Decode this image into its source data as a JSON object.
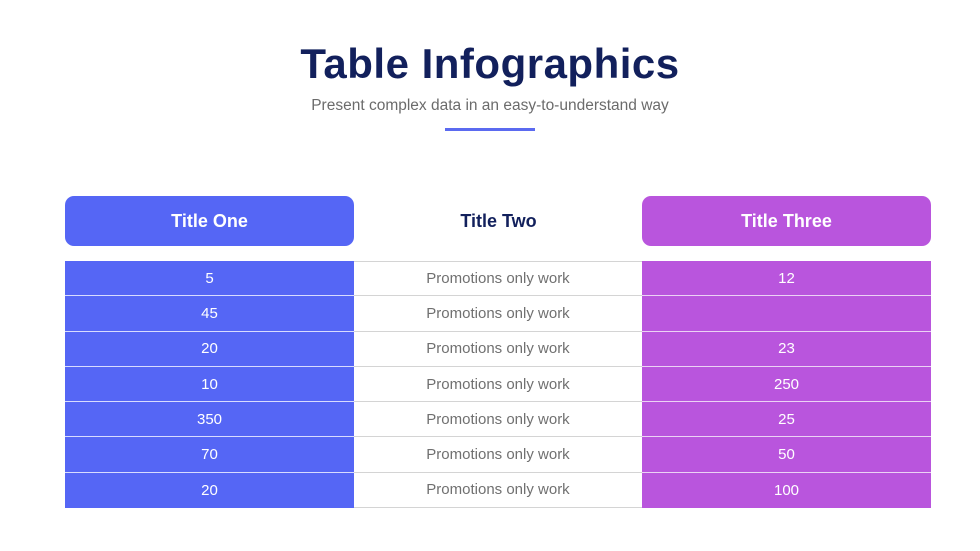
{
  "header": {
    "title": "Table Infographics",
    "subtitle": "Present complex data in an easy-to-understand way"
  },
  "colors": {
    "title": "#12205c",
    "column_one": "#5566f5",
    "column_three": "#b955dd",
    "accent_line": "#5b6af0"
  },
  "table": {
    "columns": [
      "Title One",
      "Title Two",
      "Title Three"
    ],
    "rows": [
      [
        "5",
        "Promotions only work",
        "12"
      ],
      [
        "45",
        "Promotions only work",
        ""
      ],
      [
        "20",
        "Promotions only work",
        "23"
      ],
      [
        "10",
        "Promotions only work",
        "250"
      ],
      [
        "350",
        "Promotions only work",
        "25"
      ],
      [
        "70",
        "Promotions only work",
        "50"
      ],
      [
        "20",
        "Promotions only work",
        "100"
      ]
    ]
  }
}
